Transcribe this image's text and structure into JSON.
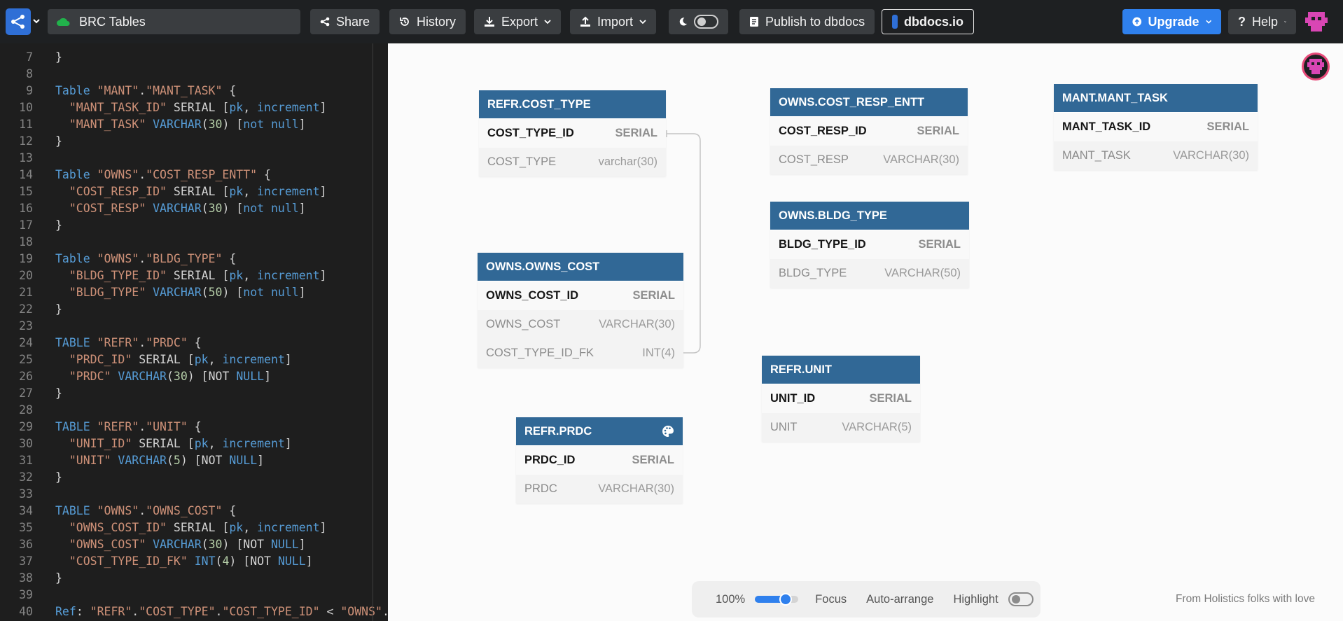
{
  "app": {
    "project_name": "BRC Tables",
    "accent": "#2f80ed",
    "header_color": "#316896"
  },
  "toolbar": {
    "share": "Share",
    "history": "History",
    "export": "Export",
    "import": "Import",
    "publish": "Publish to dbdocs",
    "dbdocs": "dbdocs.io",
    "upgrade": "Upgrade",
    "help": "Help"
  },
  "editor": {
    "lines": [
      {
        "n": "7",
        "t": [
          [
            "}",
            ""
          ]
        ]
      },
      {
        "n": "8",
        "t": []
      },
      {
        "n": "9",
        "t": [
          [
            "Table ",
            "kw"
          ],
          [
            "\"MANT\"",
            "str"
          ],
          [
            ".",
            ""
          ],
          [
            "\"MANT_TASK\"",
            "str"
          ],
          [
            " {",
            ""
          ]
        ]
      },
      {
        "n": "10",
        "t": [
          [
            "  ",
            ""
          ],
          [
            "\"MANT_TASK_ID\"",
            "str"
          ],
          [
            " SERIAL [",
            ""
          ],
          [
            "pk",
            "kw"
          ],
          [
            ", ",
            ""
          ],
          [
            "increment",
            "kw"
          ],
          [
            "]",
            ""
          ]
        ]
      },
      {
        "n": "11",
        "t": [
          [
            "  ",
            ""
          ],
          [
            "\"MANT_TASK\"",
            "str"
          ],
          [
            " ",
            ""
          ],
          [
            "VARCHAR",
            "kw"
          ],
          [
            "(",
            ""
          ],
          [
            "30",
            "num"
          ],
          [
            ") [",
            ""
          ],
          [
            "not null",
            "kw"
          ],
          [
            "]",
            ""
          ]
        ]
      },
      {
        "n": "12",
        "t": [
          [
            "}",
            ""
          ]
        ]
      },
      {
        "n": "13",
        "t": []
      },
      {
        "n": "14",
        "t": [
          [
            "Table ",
            "kw"
          ],
          [
            "\"OWNS\"",
            "str"
          ],
          [
            ".",
            ""
          ],
          [
            "\"COST_RESP_ENTT\"",
            "str"
          ],
          [
            " {",
            ""
          ]
        ]
      },
      {
        "n": "15",
        "t": [
          [
            "  ",
            ""
          ],
          [
            "\"COST_RESP_ID\"",
            "str"
          ],
          [
            " SERIAL [",
            ""
          ],
          [
            "pk",
            "kw"
          ],
          [
            ", ",
            ""
          ],
          [
            "increment",
            "kw"
          ],
          [
            "]",
            ""
          ]
        ]
      },
      {
        "n": "16",
        "t": [
          [
            "  ",
            ""
          ],
          [
            "\"COST_RESP\"",
            "str"
          ],
          [
            " ",
            ""
          ],
          [
            "VARCHAR",
            "kw"
          ],
          [
            "(",
            ""
          ],
          [
            "30",
            "num"
          ],
          [
            ") [",
            ""
          ],
          [
            "not null",
            "kw"
          ],
          [
            "]",
            ""
          ]
        ]
      },
      {
        "n": "17",
        "t": [
          [
            "}",
            ""
          ]
        ]
      },
      {
        "n": "18",
        "t": []
      },
      {
        "n": "19",
        "t": [
          [
            "Table ",
            "kw"
          ],
          [
            "\"OWNS\"",
            "str"
          ],
          [
            ".",
            ""
          ],
          [
            "\"BLDG_TYPE\"",
            "str"
          ],
          [
            " {",
            ""
          ]
        ]
      },
      {
        "n": "20",
        "t": [
          [
            "  ",
            ""
          ],
          [
            "\"BLDG_TYPE_ID\"",
            "str"
          ],
          [
            " SERIAL [",
            ""
          ],
          [
            "pk",
            "kw"
          ],
          [
            ", ",
            ""
          ],
          [
            "increment",
            "kw"
          ],
          [
            "]",
            ""
          ]
        ]
      },
      {
        "n": "21",
        "t": [
          [
            "  ",
            ""
          ],
          [
            "\"BLDG_TYPE\"",
            "str"
          ],
          [
            " ",
            ""
          ],
          [
            "VARCHAR",
            "kw"
          ],
          [
            "(",
            ""
          ],
          [
            "50",
            "num"
          ],
          [
            ") [",
            ""
          ],
          [
            "not null",
            "kw"
          ],
          [
            "]",
            ""
          ]
        ]
      },
      {
        "n": "22",
        "t": [
          [
            "}",
            ""
          ]
        ]
      },
      {
        "n": "23",
        "t": []
      },
      {
        "n": "24",
        "t": [
          [
            "TABLE ",
            "kw"
          ],
          [
            "\"REFR\"",
            "str"
          ],
          [
            ".",
            ""
          ],
          [
            "\"PRDC\"",
            "str"
          ],
          [
            " {",
            ""
          ]
        ]
      },
      {
        "n": "25",
        "t": [
          [
            "  ",
            ""
          ],
          [
            "\"PRDC_ID\"",
            "str"
          ],
          [
            " SERIAL [",
            ""
          ],
          [
            "pk",
            "kw"
          ],
          [
            ", ",
            ""
          ],
          [
            "increment",
            "kw"
          ],
          [
            "]",
            ""
          ]
        ]
      },
      {
        "n": "26",
        "t": [
          [
            "  ",
            ""
          ],
          [
            "\"PRDC\"",
            "str"
          ],
          [
            " ",
            ""
          ],
          [
            "VARCHAR",
            "kw"
          ],
          [
            "(",
            ""
          ],
          [
            "30",
            "num"
          ],
          [
            ") [NOT ",
            ""
          ],
          [
            "NULL",
            "kw"
          ],
          [
            "]",
            ""
          ]
        ]
      },
      {
        "n": "27",
        "t": [
          [
            "}",
            ""
          ]
        ]
      },
      {
        "n": "28",
        "t": []
      },
      {
        "n": "29",
        "t": [
          [
            "TABLE ",
            "kw"
          ],
          [
            "\"REFR\"",
            "str"
          ],
          [
            ".",
            ""
          ],
          [
            "\"UNIT\"",
            "str"
          ],
          [
            " {",
            ""
          ]
        ]
      },
      {
        "n": "30",
        "t": [
          [
            "  ",
            ""
          ],
          [
            "\"UNIT_ID\"",
            "str"
          ],
          [
            " SERIAL [",
            ""
          ],
          [
            "pk",
            "kw"
          ],
          [
            ", ",
            ""
          ],
          [
            "increment",
            "kw"
          ],
          [
            "]",
            ""
          ]
        ]
      },
      {
        "n": "31",
        "t": [
          [
            "  ",
            ""
          ],
          [
            "\"UNIT\"",
            "str"
          ],
          [
            " ",
            ""
          ],
          [
            "VARCHAR",
            "kw"
          ],
          [
            "(",
            ""
          ],
          [
            "5",
            "num"
          ],
          [
            ") [NOT ",
            ""
          ],
          [
            "NULL",
            "kw"
          ],
          [
            "]",
            ""
          ]
        ]
      },
      {
        "n": "32",
        "t": [
          [
            "}",
            ""
          ]
        ]
      },
      {
        "n": "33",
        "t": []
      },
      {
        "n": "34",
        "t": [
          [
            "TABLE ",
            "kw"
          ],
          [
            "\"OWNS\"",
            "str"
          ],
          [
            ".",
            ""
          ],
          [
            "\"OWNS_COST\"",
            "str"
          ],
          [
            " {",
            ""
          ]
        ]
      },
      {
        "n": "35",
        "t": [
          [
            "  ",
            ""
          ],
          [
            "\"OWNS_COST_ID\"",
            "str"
          ],
          [
            " SERIAL [",
            ""
          ],
          [
            "pk",
            "kw"
          ],
          [
            ", ",
            ""
          ],
          [
            "increment",
            "kw"
          ],
          [
            "]",
            ""
          ]
        ]
      },
      {
        "n": "36",
        "t": [
          [
            "  ",
            ""
          ],
          [
            "\"OWNS_COST\"",
            "str"
          ],
          [
            " ",
            ""
          ],
          [
            "VARCHAR",
            "kw"
          ],
          [
            "(",
            ""
          ],
          [
            "30",
            "num"
          ],
          [
            ") [NOT ",
            ""
          ],
          [
            "NULL",
            "kw"
          ],
          [
            "]",
            ""
          ]
        ]
      },
      {
        "n": "37",
        "t": [
          [
            "  ",
            ""
          ],
          [
            "\"COST_TYPE_ID_FK\"",
            "str"
          ],
          [
            " ",
            ""
          ],
          [
            "INT",
            "kw"
          ],
          [
            "(",
            ""
          ],
          [
            "4",
            "num"
          ],
          [
            ") [NOT ",
            ""
          ],
          [
            "NULL",
            "kw"
          ],
          [
            "]",
            ""
          ]
        ]
      },
      {
        "n": "38",
        "t": [
          [
            "}",
            ""
          ]
        ]
      },
      {
        "n": "39",
        "t": []
      },
      {
        "n": "40",
        "t": [
          [
            "Ref",
            "kw"
          ],
          [
            ": ",
            ""
          ],
          [
            "\"REFR\"",
            "str"
          ],
          [
            ".",
            ""
          ],
          [
            "\"COST_TYPE\"",
            "str"
          ],
          [
            ".",
            ""
          ],
          [
            "\"COST_TYPE_ID\"",
            "str"
          ],
          [
            " < ",
            ""
          ],
          [
            "\"OWNS\"",
            "str"
          ],
          [
            ".\"",
            ""
          ]
        ]
      }
    ]
  },
  "diagram": {
    "tables": [
      {
        "id": "refr-cost-type",
        "name": "REFR.COST_TYPE",
        "fields": [
          {
            "name": "COST_TYPE_ID",
            "type": "SERIAL",
            "pk": true
          },
          {
            "name": "COST_TYPE",
            "type": "varchar(30)",
            "pk": false
          }
        ]
      },
      {
        "id": "owns-cost-resp-entt",
        "name": "OWNS.COST_RESP_ENTT",
        "fields": [
          {
            "name": "COST_RESP_ID",
            "type": "SERIAL",
            "pk": true
          },
          {
            "name": "COST_RESP",
            "type": "VARCHAR(30)",
            "pk": false
          }
        ]
      },
      {
        "id": "mant-mant-task",
        "name": "MANT.MANT_TASK",
        "fields": [
          {
            "name": "MANT_TASK_ID",
            "type": "SERIAL",
            "pk": true
          },
          {
            "name": "MANT_TASK",
            "type": "VARCHAR(30)",
            "pk": false
          }
        ]
      },
      {
        "id": "owns-bldg-type",
        "name": "OWNS.BLDG_TYPE",
        "fields": [
          {
            "name": "BLDG_TYPE_ID",
            "type": "SERIAL",
            "pk": true
          },
          {
            "name": "BLDG_TYPE",
            "type": "VARCHAR(50)",
            "pk": false
          }
        ]
      },
      {
        "id": "owns-owns-cost",
        "name": "OWNS.OWNS_COST",
        "fields": [
          {
            "name": "OWNS_COST_ID",
            "type": "SERIAL",
            "pk": true
          },
          {
            "name": "OWNS_COST",
            "type": "VARCHAR(30)",
            "pk": false
          },
          {
            "name": "COST_TYPE_ID_FK",
            "type": "INT(4)",
            "pk": false
          }
        ]
      },
      {
        "id": "refr-unit",
        "name": "REFR.UNIT",
        "fields": [
          {
            "name": "UNIT_ID",
            "type": "SERIAL",
            "pk": true
          },
          {
            "name": "UNIT",
            "type": "VARCHAR(5)",
            "pk": false
          }
        ]
      },
      {
        "id": "refr-prdc",
        "name": "REFR.PRDC",
        "color_icon": "palette-icon",
        "fields": [
          {
            "name": "PRDC_ID",
            "type": "SERIAL",
            "pk": true
          },
          {
            "name": "PRDC",
            "type": "VARCHAR(30)",
            "pk": false
          }
        ]
      }
    ]
  },
  "bottombar": {
    "zoom": "100%",
    "zoom_level": 0.7,
    "focus": "Focus",
    "auto_arrange": "Auto-arrange",
    "highlight": "Highlight",
    "highlight_on": false
  },
  "footer": "From Holistics folks with love"
}
